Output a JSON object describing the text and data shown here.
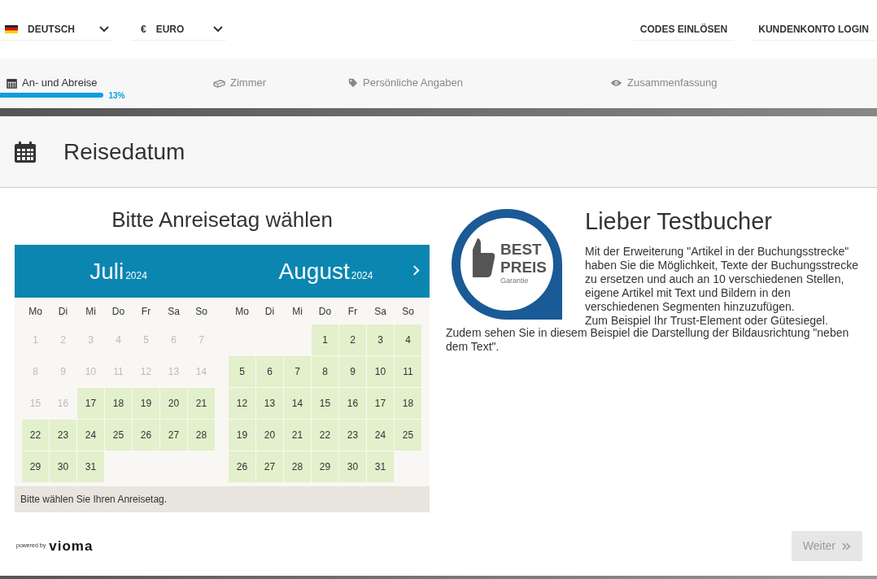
{
  "top_bar": {
    "language": {
      "label": "DEUTSCH"
    },
    "currency": {
      "symbol": "€",
      "label": "EURO"
    },
    "links": [
      "CODES EINLÖSEN",
      "KUNDENKONTO LOGIN"
    ]
  },
  "steps": [
    {
      "kind": "calendar",
      "label": "An- und Abreise",
      "selected": true
    },
    {
      "kind": "bed",
      "label": "Zimmer",
      "selected": false
    },
    {
      "kind": "tag",
      "label": "Persönliche Angaben",
      "selected": false
    },
    {
      "kind": "eye",
      "label": "Zusammenfassung",
      "selected": false
    }
  ],
  "progress": {
    "level": 0.13,
    "reading": "13%"
  },
  "section_title": "Reisedatum",
  "calendar": {
    "title": "Bitte Anreisetag wählen",
    "months": [
      {
        "name": "Juli",
        "year": "2024",
        "weekdays": [
          "Mo",
          "Di",
          "Mi",
          "Do",
          "Fr",
          "Sa",
          "So"
        ],
        "days": [
          {
            "kind": "day",
            "day": "1",
            "available": false
          },
          {
            "kind": "day",
            "day": "2",
            "available": false
          },
          {
            "kind": "day",
            "day": "3",
            "available": false
          },
          {
            "kind": "day",
            "day": "4",
            "available": false
          },
          {
            "kind": "day",
            "day": "5",
            "available": false
          },
          {
            "kind": "day",
            "day": "6",
            "available": false
          },
          {
            "kind": "day",
            "day": "7",
            "available": false
          },
          {
            "kind": "day",
            "day": "8",
            "available": false
          },
          {
            "kind": "day",
            "day": "9",
            "available": false
          },
          {
            "kind": "day",
            "day": "10",
            "available": false
          },
          {
            "kind": "day",
            "day": "11",
            "available": false
          },
          {
            "kind": "day",
            "day": "12",
            "available": false
          },
          {
            "kind": "day",
            "day": "13",
            "available": false
          },
          {
            "kind": "day",
            "day": "14",
            "available": false
          },
          {
            "kind": "day",
            "day": "15",
            "available": false
          },
          {
            "kind": "day",
            "day": "16",
            "available": false
          },
          {
            "kind": "day",
            "day": "17",
            "available": true
          },
          {
            "kind": "day",
            "day": "18",
            "available": true
          },
          {
            "kind": "day",
            "day": "19",
            "available": true
          },
          {
            "kind": "day",
            "day": "20",
            "available": true
          },
          {
            "kind": "day",
            "day": "21",
            "available": true
          },
          {
            "kind": "day",
            "day": "22",
            "available": true
          },
          {
            "kind": "day",
            "day": "23",
            "available": true
          },
          {
            "kind": "day",
            "day": "24",
            "available": true
          },
          {
            "kind": "day",
            "day": "25",
            "available": true
          },
          {
            "kind": "day",
            "day": "26",
            "available": true
          },
          {
            "kind": "day",
            "day": "27",
            "available": true
          },
          {
            "kind": "day",
            "day": "28",
            "available": true
          },
          {
            "kind": "day",
            "day": "29",
            "available": true
          },
          {
            "kind": "day",
            "day": "30",
            "available": true
          },
          {
            "kind": "day",
            "day": "31",
            "available": true
          }
        ]
      },
      {
        "name": "August",
        "year": "2024",
        "weekdays": [
          "Mo",
          "Di",
          "Mi",
          "Do",
          "Fr",
          "Sa",
          "So"
        ],
        "days": [
          {
            "kind": "blank"
          },
          {
            "kind": "blank"
          },
          {
            "kind": "blank"
          },
          {
            "kind": "day",
            "day": "1",
            "available": true
          },
          {
            "kind": "day",
            "day": "2",
            "available": true
          },
          {
            "kind": "day",
            "day": "3",
            "available": true
          },
          {
            "kind": "day",
            "day": "4",
            "available": true
          },
          {
            "kind": "day",
            "day": "5",
            "available": true
          },
          {
            "kind": "day",
            "day": "6",
            "available": true
          },
          {
            "kind": "day",
            "day": "7",
            "available": true
          },
          {
            "kind": "day",
            "day": "8",
            "available": true
          },
          {
            "kind": "day",
            "day": "9",
            "available": true
          },
          {
            "kind": "day",
            "day": "10",
            "available": true
          },
          {
            "kind": "day",
            "day": "11",
            "available": true
          },
          {
            "kind": "day",
            "day": "12",
            "available": true
          },
          {
            "kind": "day",
            "day": "13",
            "available": true
          },
          {
            "kind": "day",
            "day": "14",
            "available": true
          },
          {
            "kind": "day",
            "day": "15",
            "available": true
          },
          {
            "kind": "day",
            "day": "16",
            "available": true
          },
          {
            "kind": "day",
            "day": "17",
            "available": true
          },
          {
            "kind": "day",
            "day": "18",
            "available": true
          },
          {
            "kind": "day",
            "day": "19",
            "available": true
          },
          {
            "kind": "day",
            "day": "20",
            "available": true
          },
          {
            "kind": "day",
            "day": "21",
            "available": true
          },
          {
            "kind": "day",
            "day": "22",
            "available": true
          },
          {
            "kind": "day",
            "day": "23",
            "available": true
          },
          {
            "kind": "day",
            "day": "24",
            "available": true
          },
          {
            "kind": "day",
            "day": "25",
            "available": true
          },
          {
            "kind": "day",
            "day": "26",
            "available": true
          },
          {
            "kind": "day",
            "day": "27",
            "available": true
          },
          {
            "kind": "day",
            "day": "28",
            "available": true
          },
          {
            "kind": "day",
            "day": "29",
            "available": true
          },
          {
            "kind": "day",
            "day": "30",
            "available": true
          },
          {
            "kind": "day",
            "day": "31",
            "available": true
          }
        ]
      }
    ],
    "hint": "Bitte wählen Sie Ihren Anreisetag."
  },
  "article": {
    "badge": {
      "line_1": "BEST",
      "line_2": "PREIS",
      "line_3": "Garantie"
    },
    "title": "Lieber Testbucher",
    "body_beside_image": "Mit der Erweiterung \"Artikel in der Buchungsstrecke\" haben Sie die Möglichkeit, Texte der Buchungsstrecke zu ersetzen und auch an 10 verschiedenen Stellen, eigene Artikel mit Text und Bildern in den verschiedenen Segmenten hinzuzufügen.\nZum Beispiel Ihr Trust-Element oder Gütesiegel.",
    "body_below_image": "Zudem sehen Sie in diesem Beispiel die Darstellung der Bildausrichtung \"neben dem Text\"."
  },
  "footer": {
    "powered_by": "powered by",
    "brand": "vioma",
    "next_button": {
      "label": "Weiter",
      "disabled": true
    }
  }
}
